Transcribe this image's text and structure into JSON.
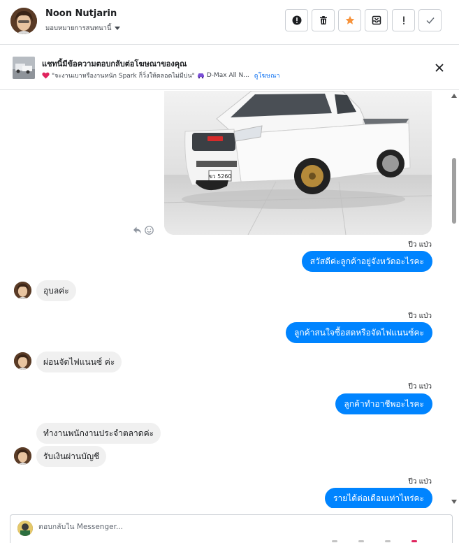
{
  "header": {
    "name": "Noon Nutjarin",
    "assign_label": "มอบหมายการสนทนานี้",
    "tools": [
      "exclamation-circle-icon",
      "trash-icon",
      "star-icon",
      "archive-icon",
      "exclamation-icon",
      "check-icon"
    ],
    "star_color": "#f7923a"
  },
  "ad": {
    "title": "แชทนี้มีข้อความตอบกลับต่อโฆษณาของคุณ",
    "sub_text": "\"จะงานเบาหรืองานหนัก Spark ก็วิ่งให้ตลอดไม่มีบ่น\"",
    "product_text": "D-Max All N...",
    "link_text": "ดูโฆษณา"
  },
  "messages": [
    {
      "dir": "out",
      "sender": "ปีว แป่ว",
      "text": "สวัสดีค่ะลูกค้าอยู่จังหวัดอะไรคะ"
    },
    {
      "dir": "in",
      "text": "อุบลค่ะ"
    },
    {
      "dir": "out",
      "sender": "ปีว แป่ว",
      "text": "ลูกค้าสนใจซื้อสดหรือจัดไฟแนนซ์คะ"
    },
    {
      "dir": "in",
      "text": "ผ่อนจัดไฟแนนซ์  ค่ะ"
    },
    {
      "dir": "out",
      "sender": "ปีว แป่ว",
      "text": "ลูกค้าทำอาชีพอะไรคะ"
    },
    {
      "dir": "in",
      "text": "ทำงานพนักงานประจำตลาดค่ะ"
    },
    {
      "dir": "in",
      "text": "รับเงินผ่านบัญชี"
    },
    {
      "dir": "out",
      "sender": "ปีว แป่ว",
      "text": "รายได้ต่อเดือนเท่าไหร่คะ"
    }
  ],
  "composer": {
    "placeholder": "ตอบกลับใน Messenger..."
  },
  "colors": {
    "outgoing_bubble": "#0084ff",
    "incoming_bubble": "#f0f0f0",
    "link": "#1877f2"
  }
}
